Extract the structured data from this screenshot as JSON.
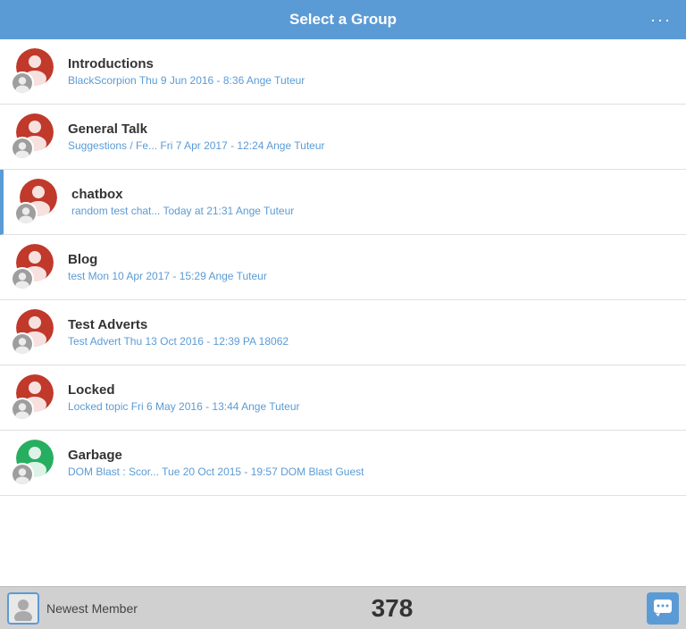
{
  "header": {
    "title": "Select a Group",
    "menu_icon": "···"
  },
  "groups": [
    {
      "id": "introductions",
      "name": "Introductions",
      "meta": "BlackScorpion Thu 9 Jun 2016 - 8:36 Ange Tuteur",
      "avatar_type": "red",
      "active": false
    },
    {
      "id": "general-talk",
      "name": "General Talk",
      "meta": "Suggestions / Fe... Fri 7 Apr 2017 - 12:24 Ange Tuteur",
      "avatar_type": "red",
      "active": false
    },
    {
      "id": "chatbox",
      "name": "chatbox",
      "meta": "random test chat... Today at 21:31 Ange Tuteur",
      "avatar_type": "red",
      "active": true
    },
    {
      "id": "blog",
      "name": "Blog",
      "meta": "test Mon 10 Apr 2017 - 15:29 Ange Tuteur",
      "avatar_type": "red",
      "active": false
    },
    {
      "id": "test-adverts",
      "name": "Test Adverts",
      "meta": "Test Advert Thu 13 Oct 2016 - 12:39 PA 18062",
      "avatar_type": "red",
      "active": false
    },
    {
      "id": "locked",
      "name": "Locked",
      "meta": "Locked topic Fri 6 May 2016 - 13:44 Ange Tuteur",
      "avatar_type": "red",
      "active": false
    },
    {
      "id": "garbage",
      "name": "Garbage",
      "meta": "DOM Blast : Scor... Tue 20 Oct 2015 - 19:57 DOM Blast Guest",
      "avatar_type": "green",
      "active": false
    }
  ],
  "footer": {
    "member_label": "Newest Member",
    "count": "378"
  }
}
